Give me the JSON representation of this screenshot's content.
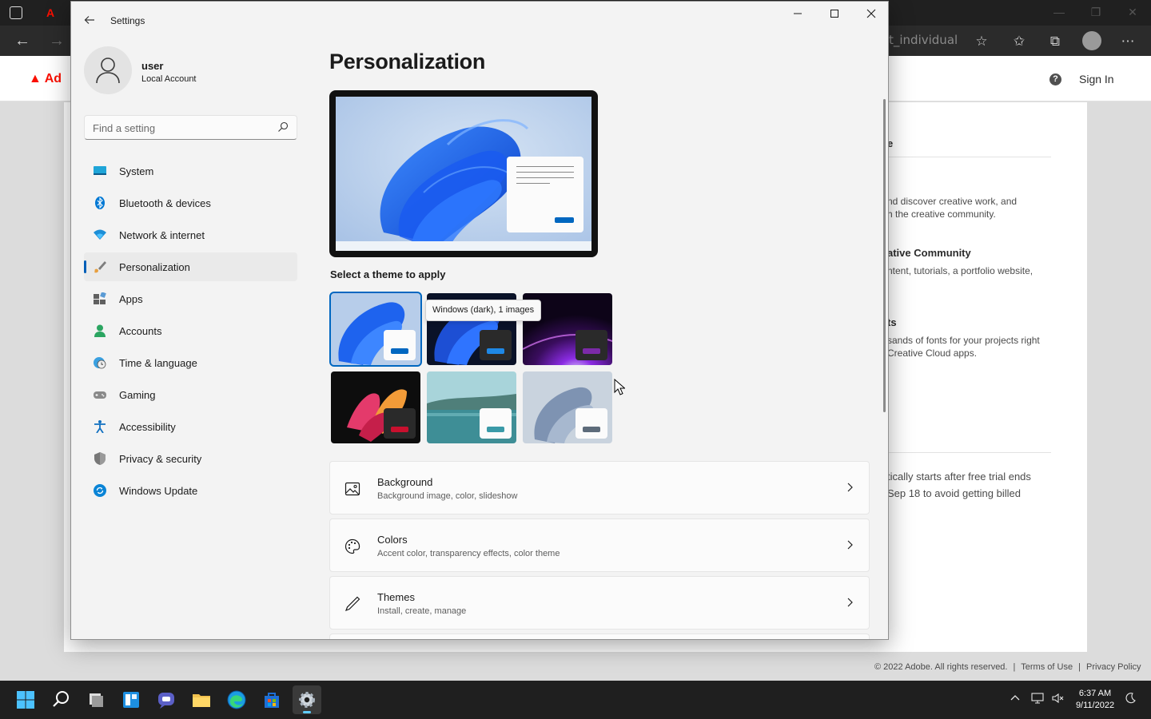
{
  "browser": {
    "address_tail": "t_individual",
    "adobe_logo_text": "Ad",
    "sign_in": "Sign In",
    "page_fragments": {
      "line1": "e",
      "line2": "nd discover creative work, and",
      "line3": "h the creative community.",
      "line4": "ative Community",
      "line5": "ntent, tutorials, a portfolio website,",
      "line6": "ts",
      "line7": "sands of fonts for your projects right",
      "line8": "Creative Cloud apps.",
      "line9": "tically starts after free trial ends",
      "line10": "Sep 18 to avoid getting billed"
    },
    "footer": {
      "copyright": "© 2022 Adobe. All rights reserved.",
      "sep": "|",
      "terms": "Terms of Use",
      "privacy": "Privacy Policy"
    }
  },
  "settings": {
    "window_title": "Settings",
    "user": {
      "name": "user",
      "account": "Local Account"
    },
    "search": {
      "placeholder": "Find a setting"
    },
    "nav": [
      {
        "label": "System",
        "icon": "system-icon",
        "color": "#0078d4"
      },
      {
        "label": "Bluetooth & devices",
        "icon": "bluetooth-icon",
        "color": "#0078d4"
      },
      {
        "label": "Network & internet",
        "icon": "wifi-icon",
        "color": "#0078d4"
      },
      {
        "label": "Personalization",
        "icon": "brush-icon",
        "color": "#e8a040",
        "active": true
      },
      {
        "label": "Apps",
        "icon": "apps-icon",
        "color": "#555555"
      },
      {
        "label": "Accounts",
        "icon": "person-icon",
        "color": "#2ba561"
      },
      {
        "label": "Time & language",
        "icon": "globe-clock-icon",
        "color": "#0078d4"
      },
      {
        "label": "Gaming",
        "icon": "gamepad-icon",
        "color": "#777777"
      },
      {
        "label": "Accessibility",
        "icon": "accessibility-icon",
        "color": "#1170c0"
      },
      {
        "label": "Privacy & security",
        "icon": "shield-icon",
        "color": "#6b6b6b"
      },
      {
        "label": "Windows Update",
        "icon": "update-icon",
        "color": "#0078d4"
      }
    ],
    "main": {
      "title": "Personalization",
      "theme_heading": "Select a theme to apply",
      "tooltip": "Windows (dark), 1 images",
      "rows": [
        {
          "title": "Background",
          "subtitle": "Background image, color, slideshow",
          "icon": "image-icon"
        },
        {
          "title": "Colors",
          "subtitle": "Accent color, transparency effects, color theme",
          "icon": "palette-icon"
        },
        {
          "title": "Themes",
          "subtitle": "Install, create, manage",
          "icon": "pen-icon"
        }
      ]
    },
    "accent_color": "#0067c0"
  },
  "taskbar": {
    "time": "6:37 AM",
    "date": "9/11/2022"
  }
}
